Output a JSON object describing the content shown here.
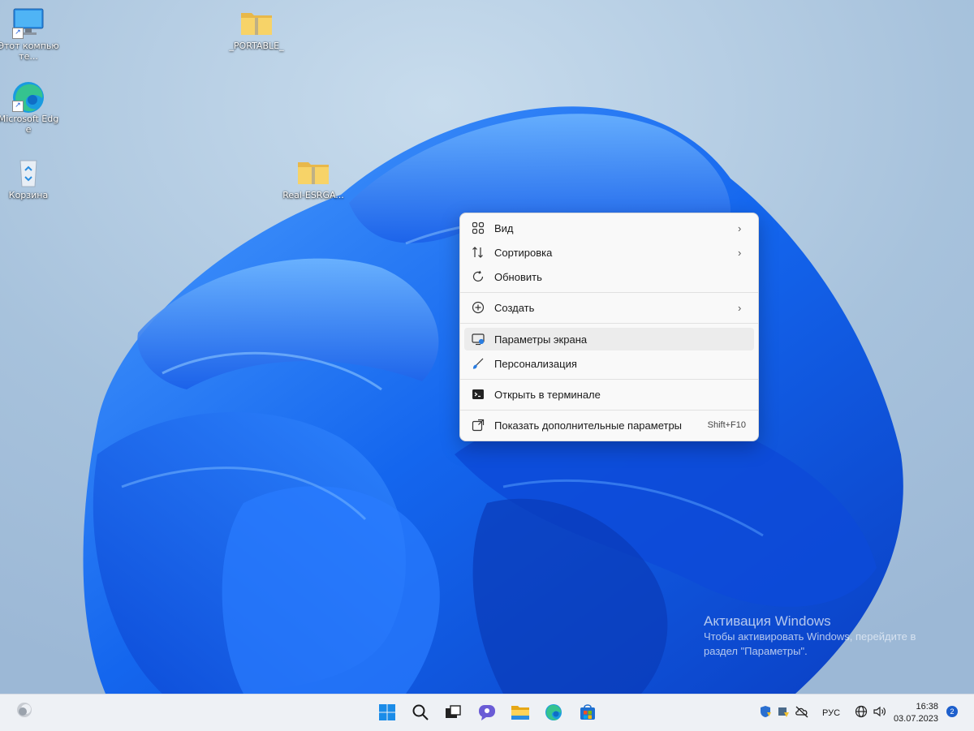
{
  "desktop": {
    "icons": [
      {
        "label": "Этот компьюте..."
      },
      {
        "label": "Microsoft Edge"
      },
      {
        "label": "Корзина"
      },
      {
        "label": "_PORTABLE_"
      },
      {
        "label": "Real-ESRGA..."
      }
    ]
  },
  "context_menu": {
    "items": [
      {
        "label": "Вид",
        "icon": "grid-icon",
        "submenu": true
      },
      {
        "label": "Сортировка",
        "icon": "sort-icon",
        "submenu": true
      },
      {
        "label": "Обновить",
        "icon": "refresh-icon"
      },
      {
        "label": "Создать",
        "icon": "plus-circle-icon",
        "submenu": true
      },
      {
        "label": "Параметры экрана",
        "icon": "display-settings-icon"
      },
      {
        "label": "Персонализация",
        "icon": "brush-icon"
      },
      {
        "label": "Открыть в терминале",
        "icon": "terminal-icon"
      },
      {
        "label": "Показать дополнительные параметры",
        "icon": "more-options-icon",
        "shortcut": "Shift+F10"
      }
    ]
  },
  "watermark": {
    "title": "Активация Windows",
    "text": "Чтобы активировать Windows, перейдите в раздел \"Параметры\"."
  },
  "taskbar": {
    "pinned": [
      "start-icon",
      "search-icon",
      "task-view-icon",
      "chat-icon",
      "file-explorer-icon",
      "edge-icon",
      "store-icon"
    ],
    "language": "РУС",
    "time": "16:38",
    "date": "03.07.2023",
    "notifications": "2"
  }
}
